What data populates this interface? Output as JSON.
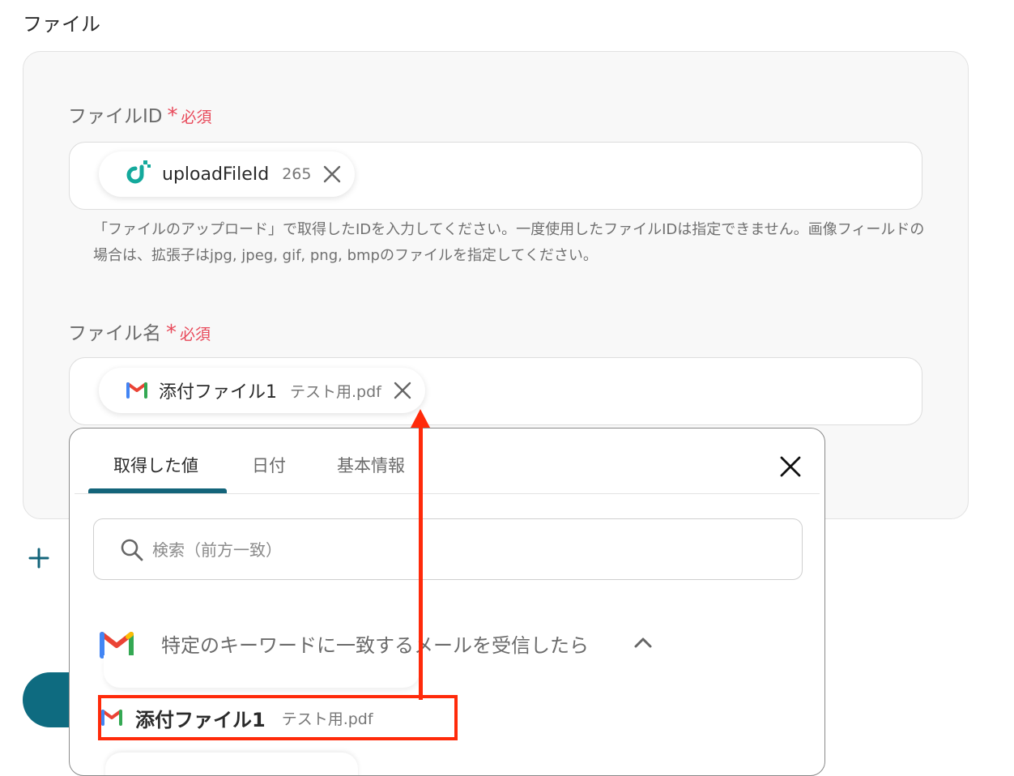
{
  "section": {
    "title": "ファイル"
  },
  "file_id": {
    "label": "ファイルID",
    "asterisk": "*",
    "required": "必須",
    "pill": {
      "icon": "yoom-upload-icon",
      "name": "uploadFileId",
      "meta": "265"
    },
    "help": "「ファイルのアップロード」で取得したIDを入力してください。一度使用したファイルIDは指定できません。画像フィールドの場合は、拡張子はjpg, jpeg, gif, png, bmpのファイルを指定してください。"
  },
  "file_name": {
    "label": "ファイル名",
    "asterisk": "*",
    "required": "必須",
    "pill": {
      "icon": "gmail-icon",
      "name": "添付ファイル1",
      "meta": "テスト用.pdf"
    }
  },
  "dropdown": {
    "tabs": [
      {
        "label": "取得した値",
        "active": true
      },
      {
        "label": "日付",
        "active": false
      },
      {
        "label": "基本情報",
        "active": false
      }
    ],
    "search": {
      "placeholder": "検索（前方一致）",
      "value": ""
    },
    "group": {
      "icon": "gmail-icon",
      "title": "特定のキーワードに一致するメールを受信したら",
      "expanded": true
    },
    "items": [
      {
        "icon": "gmail-icon",
        "name": "添付ファイル1",
        "meta": "テスト用.pdf",
        "highlighted": true
      }
    ]
  },
  "colors": {
    "accent": "#13647a",
    "required": "#e8495a",
    "annotation": "#ff2a0a",
    "yoom_logo": "#14a99c"
  }
}
